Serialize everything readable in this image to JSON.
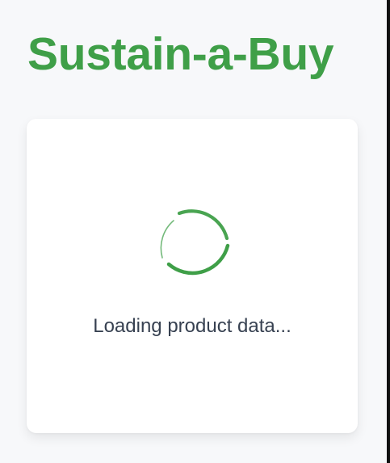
{
  "app": {
    "title": "Sustain-a-Buy"
  },
  "loading": {
    "message": "Loading product data...",
    "spinner_icon": "loading-spinner-icon"
  },
  "colors": {
    "accent": "#3f9f48",
    "background": "#f7f8fa",
    "card": "#ffffff",
    "text": "#374151"
  }
}
